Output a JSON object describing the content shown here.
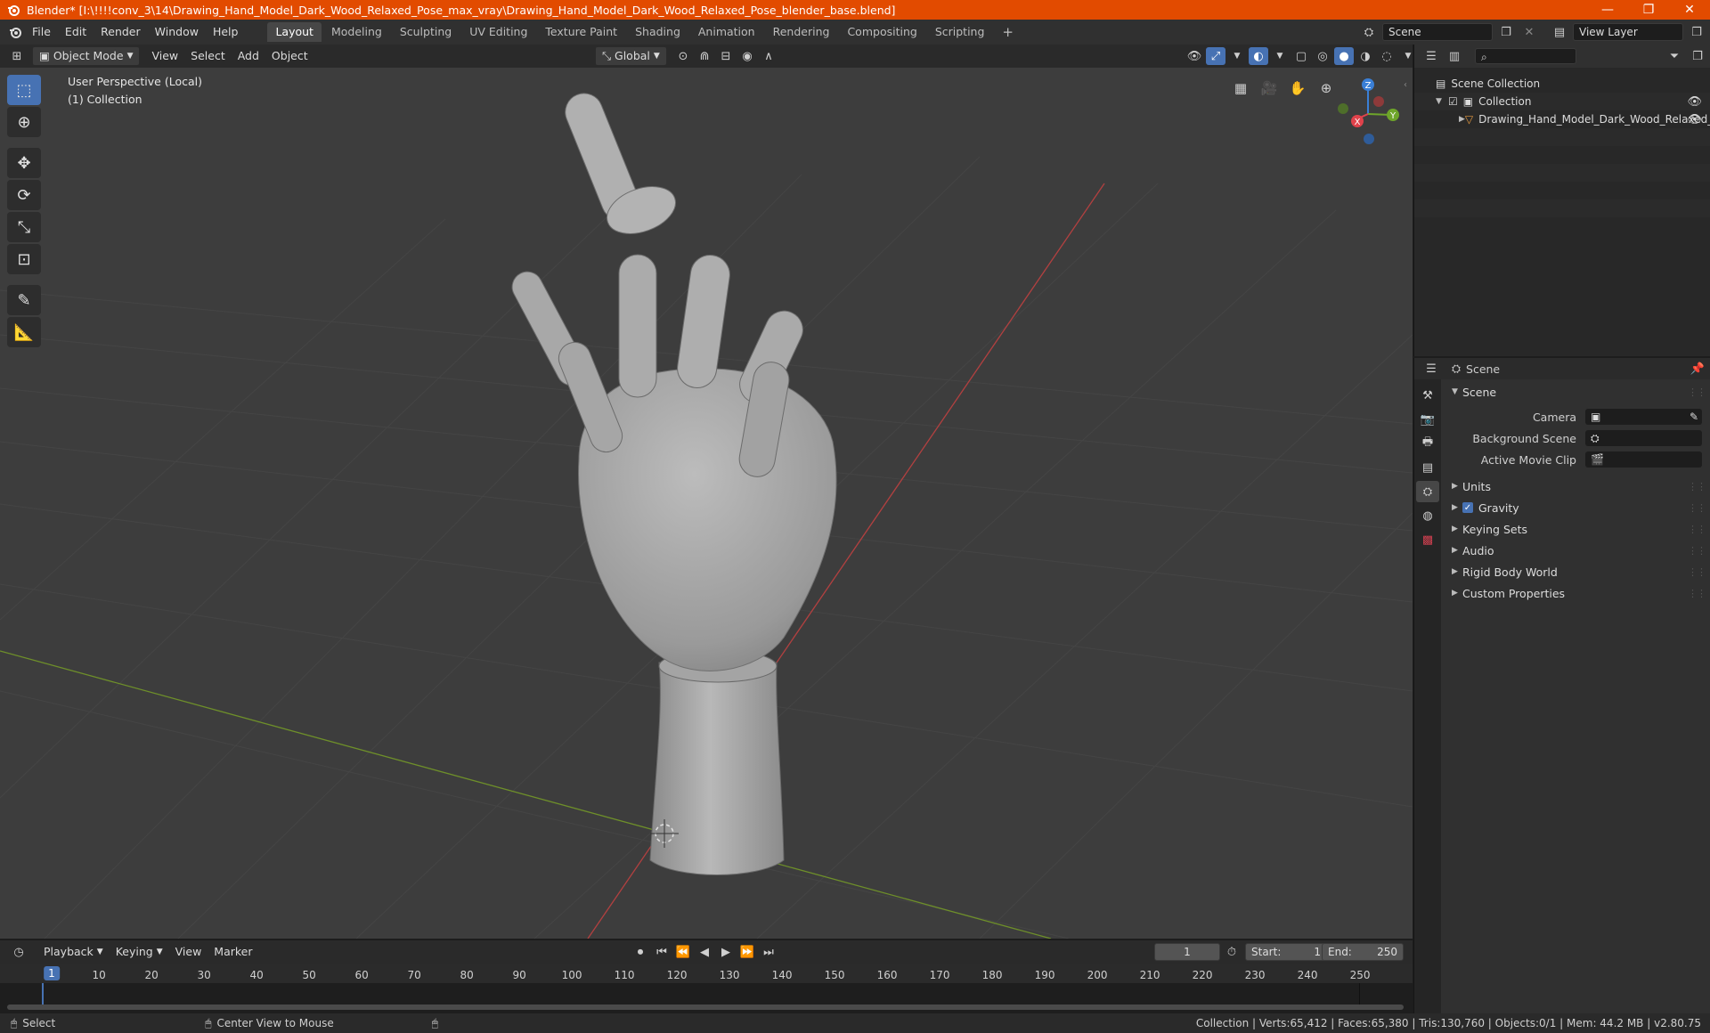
{
  "window": {
    "title": "Blender* [I:\\!!!!conv_3\\14\\Drawing_Hand_Model_Dark_Wood_Relaxed_Pose_max_vray\\Drawing_Hand_Model_Dark_Wood_Relaxed_Pose_blender_base.blend]",
    "minimize": "—",
    "maximize": "❐",
    "close": "✕"
  },
  "menu": [
    "File",
    "Edit",
    "Render",
    "Window",
    "Help"
  ],
  "workspaces": [
    "Layout",
    "Modeling",
    "Sculpting",
    "UV Editing",
    "Texture Paint",
    "Shading",
    "Animation",
    "Rendering",
    "Compositing",
    "Scripting"
  ],
  "add_workspace": "+",
  "scene_field": "Scene",
  "view_layer_field": "View Layer",
  "viewport_header": {
    "mode": "Object Mode",
    "menus": [
      "View",
      "Select",
      "Add",
      "Object"
    ],
    "transform_orientation": "Global"
  },
  "viewport": {
    "perspective": "User Perspective (Local)",
    "collection": "(1) Collection",
    "gizmo": {
      "x": "X",
      "y": "Y",
      "z": "Z"
    }
  },
  "outliner": {
    "search_placeholder": "",
    "rows": [
      {
        "label": "Scene Collection"
      },
      {
        "label": "Collection"
      },
      {
        "label": "Drawing_Hand_Model_Dark_Wood_Relaxed_"
      }
    ]
  },
  "properties": {
    "header_title": "Scene",
    "panel_title": "Scene",
    "fields": [
      {
        "label": "Camera",
        "value": ""
      },
      {
        "label": "Background Scene",
        "value": ""
      },
      {
        "label": "Active Movie Clip",
        "value": ""
      }
    ],
    "subpanels": [
      "Units",
      "Gravity",
      "Keying Sets",
      "Audio",
      "Rigid Body World",
      "Custom Properties"
    ]
  },
  "timeline": {
    "menus": [
      "Playback",
      "Keying",
      "View",
      "Marker"
    ],
    "current_frame": "1",
    "start_label": "Start:",
    "start": "1",
    "end_label": "End:",
    "end": "250",
    "ruler": [
      "1",
      "10",
      "20",
      "30",
      "40",
      "50",
      "60",
      "70",
      "80",
      "90",
      "100",
      "110",
      "120",
      "130",
      "140",
      "150",
      "160",
      "170",
      "180",
      "190",
      "200",
      "210",
      "220",
      "230",
      "240",
      "250"
    ]
  },
  "statusbar": {
    "left": "Select",
    "middle": "Center View to Mouse",
    "right": "Collection | Verts:65,412 | Faces:65,380 | Tris:130,760 | Objects:0/1 | Mem: 44.2 MB | v2.80.75"
  },
  "colors": {
    "accent": "#4772b3",
    "title_bar": "#e24b00",
    "x_axis": "#e0424b",
    "y_axis": "#6ea52a",
    "z_axis": "#3a7fd6"
  }
}
